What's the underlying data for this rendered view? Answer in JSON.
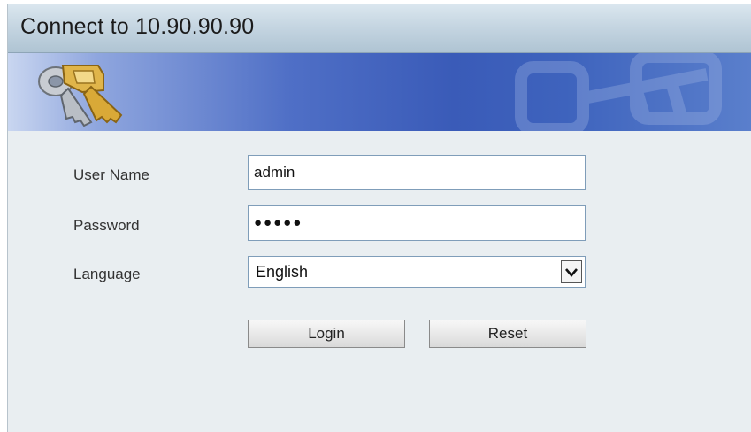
{
  "window": {
    "title": "Connect to 10.90.90.90"
  },
  "banner": {
    "icon": "keys-icon",
    "background_icon": "key-watermark-icon"
  },
  "form": {
    "username_label": "User Name",
    "username_value": "admin",
    "password_label": "Password",
    "password_value": "●●●●●",
    "language_label": "Language",
    "language_selected": "English",
    "login_label": "Login",
    "reset_label": "Reset"
  },
  "colors": {
    "title_bar": "#c6d6e2",
    "banner_blue": "#3a5bb8",
    "panel_bg": "#e9eef1",
    "field_border": "#7f9db9"
  }
}
